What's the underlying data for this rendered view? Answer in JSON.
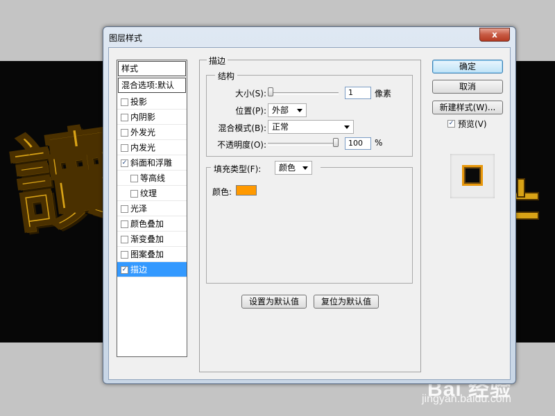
{
  "window": {
    "title": "图层样式",
    "close_label": "x"
  },
  "styles_list": {
    "header": "样式",
    "blend_options": "混合选项:默认",
    "items": [
      {
        "label": "投影",
        "checked": false,
        "sub": false,
        "selected": false
      },
      {
        "label": "内阴影",
        "checked": false,
        "sub": false,
        "selected": false
      },
      {
        "label": "外发光",
        "checked": false,
        "sub": false,
        "selected": false
      },
      {
        "label": "内发光",
        "checked": false,
        "sub": false,
        "selected": false
      },
      {
        "label": "斜面和浮雕",
        "checked": true,
        "sub": false,
        "selected": false
      },
      {
        "label": "等高线",
        "checked": false,
        "sub": true,
        "selected": false
      },
      {
        "label": "纹理",
        "checked": false,
        "sub": true,
        "selected": false
      },
      {
        "label": "光泽",
        "checked": false,
        "sub": false,
        "selected": false
      },
      {
        "label": "颜色叠加",
        "checked": false,
        "sub": false,
        "selected": false
      },
      {
        "label": "渐变叠加",
        "checked": false,
        "sub": false,
        "selected": false
      },
      {
        "label": "图案叠加",
        "checked": false,
        "sub": false,
        "selected": false
      },
      {
        "label": "描边",
        "checked": true,
        "sub": false,
        "selected": true
      }
    ]
  },
  "stroke_panel": {
    "title": "描边",
    "structure": {
      "title": "结构",
      "size_label": "大小(S):",
      "size_value": "1",
      "size_unit": "像素",
      "size_fraction": 0.0,
      "position_label": "位置(P):",
      "position_value": "外部",
      "blend_label": "混合模式(B):",
      "blend_value": "正常",
      "opacity_label": "不透明度(O):",
      "opacity_value": "100",
      "opacity_unit": "%",
      "opacity_fraction": 1.0
    },
    "fill": {
      "type_label": "填充类型(F):",
      "type_value": "颜色",
      "color_label": "颜色:",
      "color": "#ff9900"
    },
    "set_default_label": "设置为默认值",
    "reset_default_label": "复位为默认值"
  },
  "actions": {
    "ok_label": "确定",
    "cancel_label": "取消",
    "new_style_label": "新建样式(W)...",
    "preview_label": "预览(V)",
    "preview_checked": true
  },
  "background": {
    "canvas_char": "讀",
    "watermark_brand": "Bai 经验",
    "watermark_url": "jingyan.baidu.com"
  },
  "colors": {
    "selected_bg": "#3399ff",
    "gold": "#d9a316",
    "stroke_orange": "#ff9900"
  }
}
